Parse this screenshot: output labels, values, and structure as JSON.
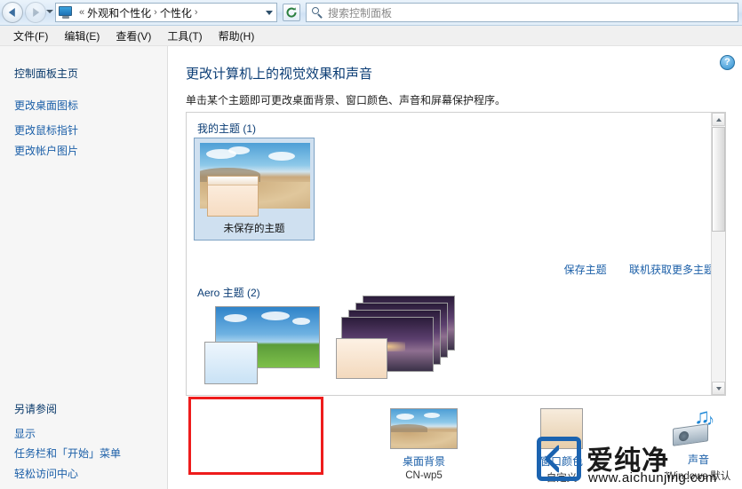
{
  "titlebar": {
    "back_tooltip": "后退",
    "forward_tooltip": "前进",
    "breadcrumb": [
      "外观和个性化",
      "个性化"
    ],
    "breadcrumb_prefix": "«",
    "separator": "›",
    "refresh_tooltip": "刷新",
    "search_placeholder": "搜索控制面板"
  },
  "menu": {
    "items": [
      "文件(F)",
      "编辑(E)",
      "查看(V)",
      "工具(T)",
      "帮助(H)"
    ]
  },
  "sidebar": {
    "heading": "控制面板主页",
    "links": [
      "更改桌面图标",
      "更改鼠标指针",
      "更改帐户图片"
    ],
    "see_also_heading": "另请参阅",
    "see_also": [
      "显示",
      "任务栏和「开始」菜单",
      "轻松访问中心"
    ]
  },
  "main": {
    "help_glyph": "?",
    "title": "更改计算机上的视觉效果和声音",
    "subtitle": "单击某个主题即可更改桌面背景、窗口颜色、声音和屏幕保护程序。",
    "groups": [
      {
        "label": "我的主题 (1)"
      },
      {
        "label": "Aero 主题 (2)"
      }
    ],
    "selected_theme_caption": "未保存的主题",
    "links": [
      {
        "label": "保存主题"
      },
      {
        "label": "联机获取更多主题"
      }
    ]
  },
  "bottom_items": [
    {
      "name": "desktop-background",
      "label": "桌面背景",
      "sub": "CN-wp5"
    },
    {
      "name": "window-color",
      "label": "窗口颜色",
      "sub": "自定义"
    },
    {
      "name": "sounds",
      "label": "声音",
      "sub": "Windows 默认"
    },
    {
      "name": "screensaver",
      "label": "",
      "sub": ""
    }
  ],
  "watermark": {
    "text": "爱纯净",
    "url": "www.aichunjing.com"
  },
  "colors": {
    "link": "#1b5fa8",
    "heading": "#0b3d75",
    "highlight_box": "#ee1c1c",
    "selection": "#cfe0f0"
  }
}
